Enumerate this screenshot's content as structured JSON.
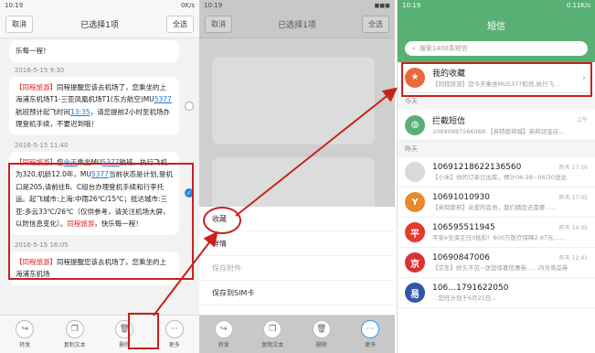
{
  "left": {
    "status_time": "10:19",
    "status_right": "0K/s",
    "cancel": "取消",
    "title": "已选择1项",
    "select_all": "全选",
    "top_partial": "乐每一程！",
    "msg1_ts": "2016-5-15 9:30",
    "msg1": {
      "tag": "【同程",
      "tag2": "旅游】",
      "p1": "同程提醒您该去机场了，您乘坐的上海浦东机场T1-三亚凤凰机场T1(东方航空)MU",
      "link1": "5377",
      "p2": " 航班预计起飞时间",
      "link2": "13:35",
      "p3": "，请您提前2小时至机场办理登机手续，不要迟到哦！"
    },
    "msg2_ts": "2016-5-15 11:40",
    "msg2": {
      "tag": "【同程",
      "tag2": "旅游】",
      "p1": "您",
      "link1": "今天",
      "p2": "乘坐MU",
      "link2": "5377",
      "p3": "航班，执行飞机为320,机龄12.0年，MU",
      "link3": "5377",
      "p4": "当前状态是计划,登机口是205,请前往B、C组台办理登机手续和行李托运。起飞城市:上海:中雨26℃/15℃；抵达城市:三亚:多云33℃/26℃（仅供参考，请关注机场大屏，以防信息变化）。",
      "tag3": "同程",
      "tag4": "旅游",
      "p5": "，快乐每一程！"
    },
    "msg3_ts": "2016-5-15 16:05",
    "msg3": {
      "tag": "【同程",
      "tag2": "旅游】",
      "p1": "同程提醒您该去机场了，您乘坐的上海浦东机场"
    },
    "toolbar": [
      {
        "icon": "↪",
        "label": "转发"
      },
      {
        "icon": "❐",
        "label": "复制文本"
      },
      {
        "icon": "🗑",
        "label": "删除"
      },
      {
        "icon": "···",
        "label": "更多"
      }
    ]
  },
  "middle": {
    "status_time": "10:19",
    "cancel": "取消",
    "title": "已选择1项",
    "select_all": "全选",
    "menu": [
      "收藏",
      "详情",
      "保存附件",
      "保存到SIM卡"
    ],
    "toolbar": [
      {
        "icon": "↪",
        "label": "转发"
      },
      {
        "icon": "❐",
        "label": "复制文本"
      },
      {
        "icon": "🗑",
        "label": "删除"
      },
      {
        "icon": "···",
        "label": "更多"
      }
    ]
  },
  "right": {
    "status_time": "10:19",
    "status_right": "0.11K/s",
    "title": "短信",
    "search_placeholder": "搜索1400条短信",
    "favorites": {
      "name": "我的收藏",
      "snippet": "【同程旅游】您今天乘坐MU5377航班,执行飞..."
    },
    "today_label": "今天",
    "blocked": {
      "name": "拦截短信",
      "snippet": "10690987566068:【英特斯邦城】英邦润宝店...",
      "time": "上午"
    },
    "yesterday_label": "昨天",
    "rows": [
      {
        "name": "10691218622136560",
        "snippet": "【小米】你的订单已出库，预计06-28~06/30送达",
        "time": "昨天 17:56",
        "color": "#d9d9d9",
        "mark": ""
      },
      {
        "name": "10691010930",
        "snippet": "【英特斯邦】亲爱的会员，我们猜您还需要……",
        "time": "昨天 17:05",
        "color": "#e8892b",
        "mark": "Y"
      },
      {
        "name": "106595511945",
        "snippet": "平安e生保正日0抵扣！600万医疗保障2.97元……",
        "time": "昨天 14:05",
        "color": "#e33a2e",
        "mark": "平"
      },
      {
        "name": "10690847006",
        "snippet": "【京东】好久不见~送您惊喜优惠券……内含商品券",
        "time": "昨天 12:41",
        "color": "#e03030",
        "mark": "京"
      },
      {
        "name": "106…1791622050",
        "snippet": "…您旺计划于6月25日…",
        "time": "",
        "color": "#3355aa",
        "mark": "易"
      }
    ]
  },
  "colors": {
    "accent_green": "#58b074",
    "highlight_red": "#c8221c"
  }
}
